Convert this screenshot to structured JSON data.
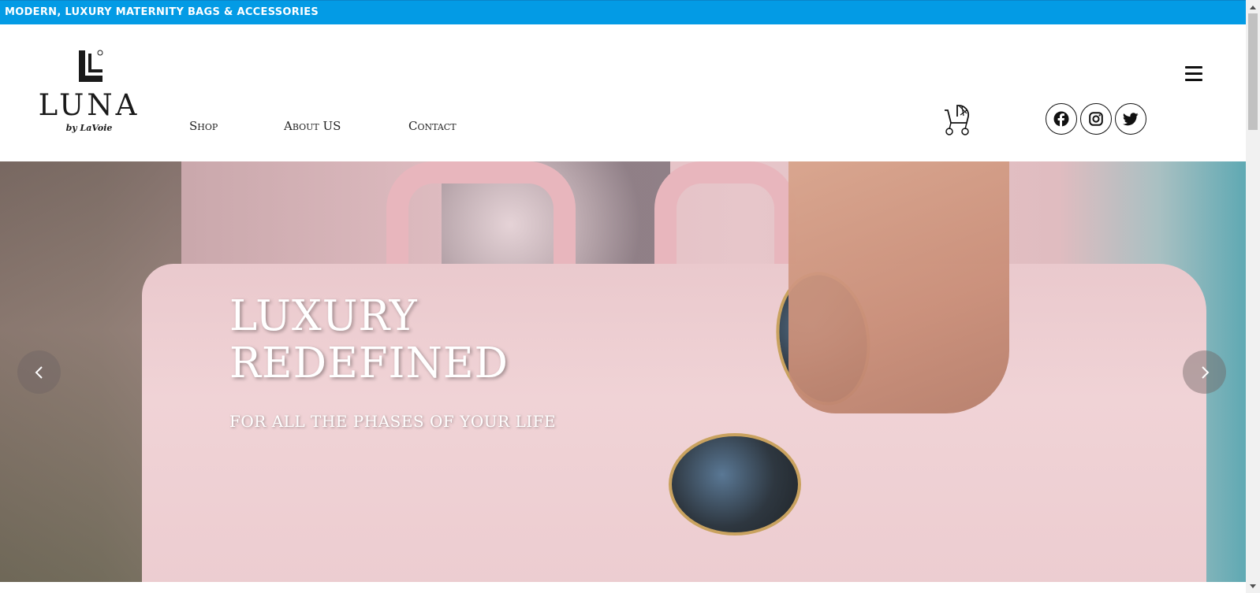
{
  "topbar": {
    "text": "MODERN, LUXURY MATERNITY BAGS & ACCESSORIES"
  },
  "logo": {
    "word": "LUNA",
    "sub": "by LaVoie"
  },
  "nav": {
    "items": [
      "Shop",
      "About US",
      "Contact"
    ]
  },
  "icons": {
    "cart": "stroller-icon",
    "facebook": "facebook-icon",
    "instagram": "instagram-icon",
    "twitter": "twitter-icon",
    "menu": "hamburger-menu-icon",
    "prev": "chevron-left-icon",
    "next": "chevron-right-icon"
  },
  "hero": {
    "headline_line1": "LUXURY",
    "headline_line2": "REDEFINED",
    "subline": "FOR ALL THE PHASES OF YOUR LIFE"
  },
  "colors": {
    "topbar": "#039be5",
    "text": "#222222",
    "hero_text": "#ffffff"
  }
}
